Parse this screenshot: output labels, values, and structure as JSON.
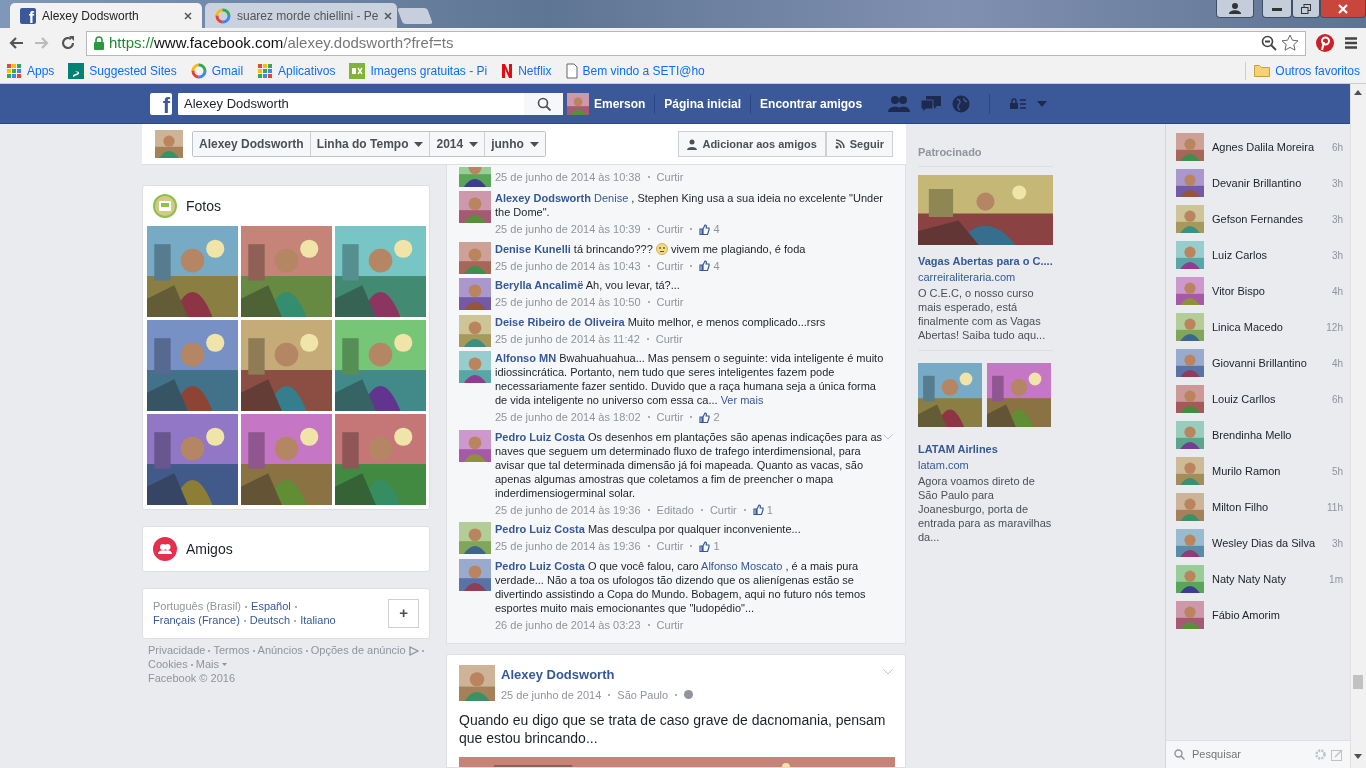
{
  "browser": {
    "tabs": [
      {
        "title": "Alexey Dodsworth",
        "kind": "facebook",
        "logo": "f",
        "selected": true
      },
      {
        "title": "suarez morde chiellini - Pe",
        "kind": "google",
        "selected": false
      }
    ],
    "url": {
      "scheme": "https://",
      "host": "www.facebook.com",
      "path": "/alexey.dodsworth?fref=ts"
    },
    "bookmarks": [
      {
        "label": "Apps",
        "kind": "grid"
      },
      {
        "label": "Suggested Sites",
        "kind": "bing"
      },
      {
        "label": "Gmail",
        "kind": "google"
      },
      {
        "label": "Aplicativos",
        "kind": "grid"
      },
      {
        "label": "Imagens gratuitas - Pi",
        "kind": "px"
      },
      {
        "label": "Netflix",
        "kind": "netflix"
      },
      {
        "label": "Bem vindo a SETI@ho",
        "kind": "page"
      }
    ],
    "other_bookmarks": "Outros favoritos"
  },
  "topbar": {
    "logo": "f",
    "search": "Alexey Dodsworth",
    "user": "Emerson",
    "links": [
      "Página inicial",
      "Encontrar amigos"
    ]
  },
  "timeline_header": {
    "selectors": [
      {
        "label": "Alexey Dodsworth",
        "dropdown": false
      },
      {
        "label": "Linha do Tempo",
        "dropdown": true
      },
      {
        "label": "2014",
        "dropdown": true
      },
      {
        "label": "junho",
        "dropdown": true
      }
    ],
    "buttons": [
      {
        "label": "Adicionar aos amigos",
        "kind": "person"
      },
      {
        "label": "Seguir",
        "kind": "feed"
      }
    ]
  },
  "photos": {
    "title": "Fotos"
  },
  "friends": {
    "title": "Amigos"
  },
  "languages": [
    {
      "label": "Português (Brasil)",
      "selected": true
    },
    {
      "label": "Español",
      "selected": false
    },
    {
      "label": "Français (France)",
      "selected": false
    },
    {
      "label": "Deutsch",
      "selected": false
    },
    {
      "label": "Italiano",
      "selected": false
    }
  ],
  "add_language": "+",
  "footer_links": [
    "Privacidade",
    "Termos",
    "Anúncios",
    "Opções de anúncio",
    "Cookies",
    "Mais"
  ],
  "copyright": "Facebook © 2016",
  "comments": [
    {
      "date": "25 de junho de 2014 às 10:38",
      "like": "Curtir"
    },
    {
      "author": "Alexey Dodsworth",
      "body": [
        {
          "kind": "link",
          "text": "Denise"
        },
        {
          "kind": "text",
          "text": ", Stephen King usa a sua ideia no excelente \"Under the Dome\"."
        }
      ],
      "date": "25 de junho de 2014 às 10:39",
      "like": "Curtir",
      "likes": "4"
    },
    {
      "author": "Denise Kunelli",
      "body": [
        {
          "kind": "text",
          "text": "tá brincando???"
        },
        {
          "kind": "emoji"
        },
        {
          "kind": "text",
          "text": "vivem me plagiando, é foda"
        }
      ],
      "date": "25 de junho de 2014 às 10:43",
      "like": "Curtir",
      "likes": "4"
    },
    {
      "author": "Berylla Ancalimë",
      "body": [
        {
          "kind": "text",
          "text": "Ah, vou levar, tá?..."
        }
      ],
      "date": "25 de junho de 2014 às 10:50",
      "like": "Curtir"
    },
    {
      "author": "Deise Ribeiro de Oliveira",
      "body": [
        {
          "kind": "text",
          "text": "Muito melhor, e menos complicado...rsrs"
        }
      ],
      "date": "25 de junho de 2014 às 11:42",
      "like": "Curtir"
    },
    {
      "author": "Alfonso MN",
      "body": [
        {
          "kind": "text",
          "text": "Bwahuahuahua... Mas pensem o seguinte: vida inteligente é muito idiossincrática. Portanto, nem tudo que seres inteligentes fazem pode necessariamente fazer sentido. Duvido que a raça humana seja a única forma de vida inteligente no universo com essa ca..."
        },
        {
          "kind": "link",
          "text": "Ver mais"
        }
      ],
      "date": "25 de junho de 2014 às 18:02",
      "like": "Curtir",
      "likes": "2"
    },
    {
      "author": "Pedro Luiz Costa",
      "body": [
        {
          "kind": "text",
          "text": "Os desenhos em plantações são apenas indicações para as naves que seguem um determinado fluxo de trafego interdimensional, para avisar que tal determinada dimensão já foi mapeada. Quanto as vacas, são apenas algumas amostras que coletamos a fim de preencher o mapa inderdimensiogerminal solar."
        }
      ],
      "date": "25 de junho de 2014 às 19:36",
      "edited": "Editado",
      "like": "Curtir",
      "likes": "1",
      "menu": true
    },
    {
      "author": "Pedro Luiz Costa",
      "body": [
        {
          "kind": "text",
          "text": "Mas desculpa por qualquer inconveniente..."
        }
      ],
      "date": "25 de junho de 2014 às 19:36",
      "like": "Curtir",
      "likes": "1"
    },
    {
      "author": "Pedro Luiz Costa",
      "body": [
        {
          "kind": "text",
          "text": "O que você falou, caro"
        },
        {
          "kind": "link",
          "text": "Alfonso Moscato"
        },
        {
          "kind": "text",
          "text": ", é a mais pura verdade... Não a toa os ufologos tão dizendo que os alienígenas estão se divertindo assistindo a Copa do Mundo. Bobagem, aqui no futuro nós temos esportes muito mais emocionantes que \"ludopédio\"..."
        }
      ],
      "date": "26 de junho de 2014 às 03:23",
      "like": "Curtir"
    }
  ],
  "post": {
    "author": "Alexey Dodsworth",
    "date": "25 de junho de 2014",
    "location": "São Paulo",
    "text": "Quando eu digo que se trata de caso grave de dacnomania, pensam que estou brincando..."
  },
  "ads": {
    "title": "Patrocinado",
    "items": [
      {
        "kind": "single",
        "title": "Vagas Abertas para o C....",
        "domain": "carreiraliteraria.com",
        "text": "O C.E.C, o nosso curso mais esperado, está finalmente com as Vagas Abertas! Saiba tudo aqu..."
      },
      {
        "kind": "double",
        "title": "LATAM Airlines",
        "domain": "latam.com",
        "text": "Agora voamos direto de São Paulo para Joanesburgo, porta de entrada para as maravilhas da..."
      }
    ]
  },
  "chat": {
    "contacts": [
      {
        "name": "Agnes Dalila Moreira",
        "time": "6h"
      },
      {
        "name": "Devanir Brillantino",
        "time": "3h"
      },
      {
        "name": "Gefson Fernandes",
        "time": "3h"
      },
      {
        "name": "Luiz Carlos",
        "time": "3h"
      },
      {
        "name": "Vitor Bispo",
        "time": "4h"
      },
      {
        "name": "Linica Macedo",
        "time": "12h"
      },
      {
        "name": "Giovanni Brillantino",
        "time": "4h"
      },
      {
        "name": "Louiz Carllos",
        "time": "6h"
      },
      {
        "name": "Brendinha Mello"
      },
      {
        "name": "Murilo Ramon",
        "time": "5h"
      },
      {
        "name": "Milton Filho",
        "time": "11h"
      },
      {
        "name": "Wesley Dias da Silva",
        "time": "3h"
      },
      {
        "name": "Naty Naty Naty",
        "time": "1m"
      },
      {
        "name": "Fábio Amorim"
      }
    ],
    "search_placeholder": "Pesquisar"
  }
}
